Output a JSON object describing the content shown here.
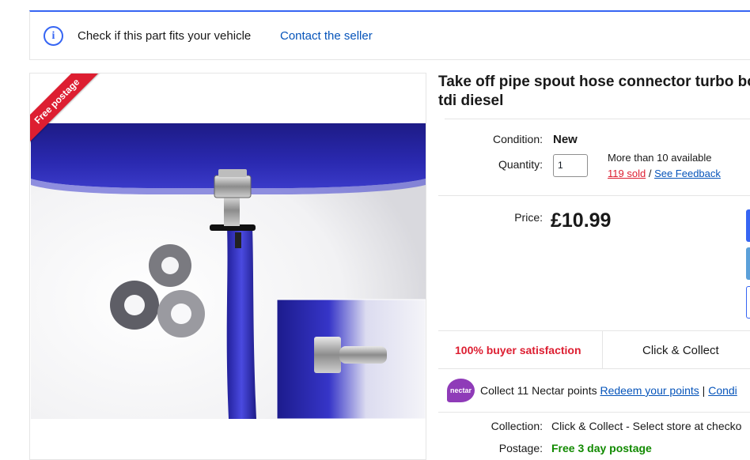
{
  "fitment": {
    "check_label": "Check if this part fits your vehicle",
    "contact_label": "Contact the seller"
  },
  "gallery": {
    "ribbon": "Free postage"
  },
  "listing": {
    "title": "Take off pipe spout hose connector turbo boo tdi diesel",
    "condition_label": "Condition:",
    "condition_value": "New",
    "quantity_label": "Quantity:",
    "quantity_value": "1",
    "available": "More than 10 available",
    "sold": "119 sold",
    "separator": "/",
    "feedback_link": "See Feedback",
    "price_label": "Price:",
    "price_value": "£10.99"
  },
  "badges": {
    "satisfaction": "100% buyer satisfaction",
    "click_collect": "Click & Collect"
  },
  "nectar": {
    "logo": "nectar",
    "collect_text": "Collect 11 Nectar points",
    "redeem_link": "Redeem your points",
    "divider": "|",
    "conditions_link": "Condi"
  },
  "shipping": {
    "collection_label": "Collection:",
    "collection_value": "Click & Collect - Select store at checko",
    "postage_label": "Postage:",
    "postage_value": "Free 3 day postage"
  },
  "colors": {
    "accent": "#3665f3",
    "link": "#0654ba",
    "red": "#dd1e31",
    "green": "#118a00",
    "nectar": "#8f3bb8"
  }
}
